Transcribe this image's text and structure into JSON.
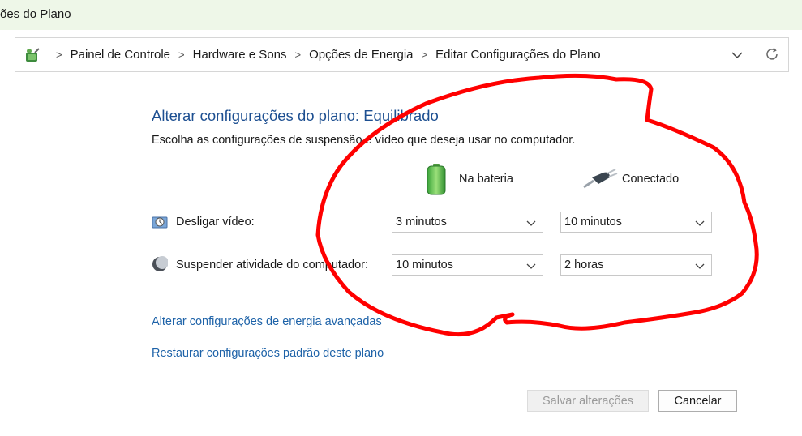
{
  "window": {
    "title": "ões do Plano"
  },
  "address_bar": {
    "app_icon": "control-panel-icon",
    "breadcrumbs": [
      "Painel de Controle",
      "Hardware e Sons",
      "Opções de Energia",
      "Editar Configurações do Plano"
    ],
    "dropdown_icon": "chevron-down-icon",
    "refresh_icon": "refresh-icon"
  },
  "main": {
    "heading": "Alterar configurações do plano: Equilibrado",
    "subtitle": "Escolha as configurações de suspensão e vídeo que deseja usar no computador.",
    "columns": [
      {
        "label": "Na bateria",
        "icon": "battery-icon"
      },
      {
        "label": "Conectado",
        "icon": "power-plug-icon"
      }
    ],
    "settings": [
      {
        "label": "Desligar vídeo:",
        "icon": "display-clock-icon",
        "battery_value": "3 minutos",
        "plugged_value": "10 minutos"
      },
      {
        "label": "Suspender atividade do computador:",
        "icon": "moon-sleep-icon",
        "battery_value": "10 minutos",
        "plugged_value": "2 horas"
      }
    ],
    "links": [
      "Alterar configurações de energia avançadas",
      "Restaurar configurações padrão deste plano"
    ]
  },
  "footer": {
    "save_label": "Salvar alterações",
    "cancel_label": "Cancelar"
  },
  "colors": {
    "heading": "#1d4f91",
    "link": "#1d62a8",
    "titlebar_bg": "#eef7e8",
    "annotation_stroke": "#ff0000"
  }
}
